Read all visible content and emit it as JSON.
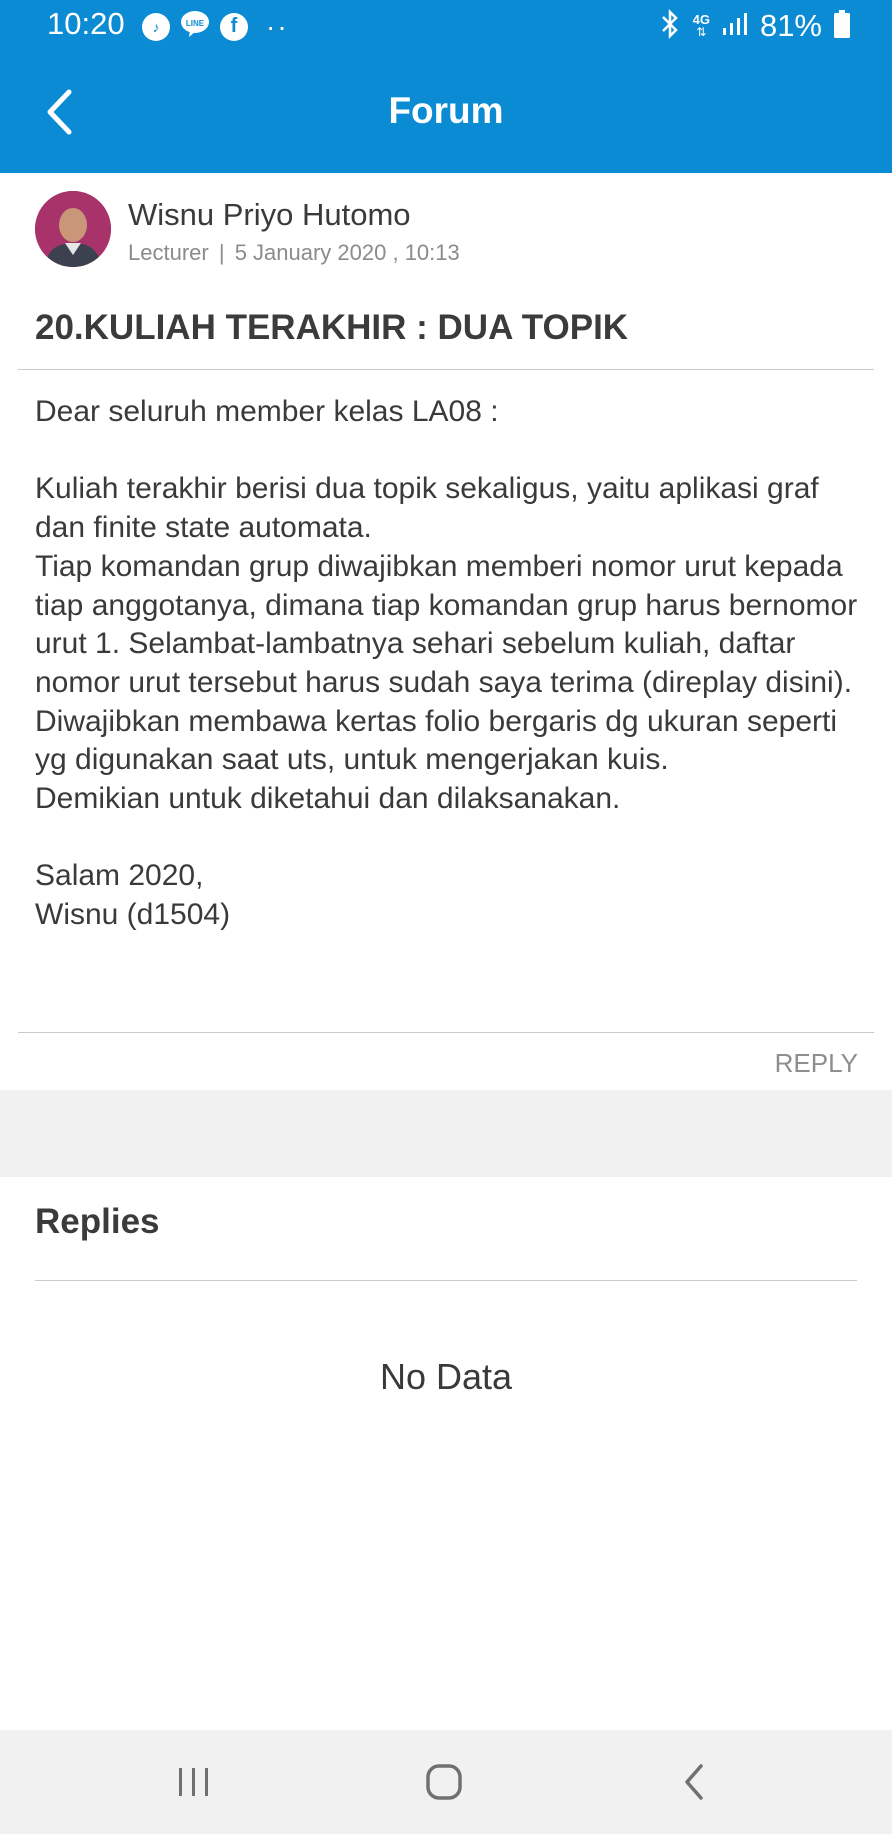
{
  "status_bar": {
    "time": "10:20",
    "battery": "81%",
    "network": "4G",
    "icons": [
      "music-icon",
      "line-icon",
      "facebook-icon",
      "more-dots-icon",
      "bluetooth-icon",
      "network-4g-icon",
      "signal-icon",
      "battery-icon"
    ]
  },
  "appbar": {
    "title": "Forum",
    "back_icon": "chevron-left-icon"
  },
  "post": {
    "author": "Wisnu Priyo Hutomo",
    "role": "Lecturer",
    "separator": "|",
    "date": "5 January 2020 , 10:13",
    "title": "20.KULIAH TERAKHIR : DUA TOPIK",
    "body": [
      "Dear seluruh member kelas LA08 :",
      "",
      "Kuliah terakhir berisi dua topik sekaligus, yaitu aplikasi graf dan finite state automata.",
      "Tiap komandan grup diwajibkan memberi nomor urut kepada tiap anggotanya, dimana tiap komandan grup harus bernomor urut 1. Selambat-lambatnya sehari sebelum kuliah, daftar nomor urut tersebut harus sudah saya terima (direplay disini).",
      "Diwajibkan membawa kertas folio bergaris dg ukuran seperti yg digunakan saat uts, untuk mengerjakan kuis.",
      "Demikian untuk diketahui dan dilaksanakan.",
      "",
      "Salam 2020,",
      "Wisnu (d1504)"
    ],
    "reply_label": "REPLY"
  },
  "replies": {
    "heading": "Replies",
    "empty_text": "No Data"
  },
  "navbar": {
    "icons": [
      "recent-apps-icon",
      "home-icon",
      "back-icon"
    ]
  },
  "colors": {
    "primary": "#0B8BD3",
    "text": "#3a3a3a",
    "muted": "#8b8b8b",
    "band": "#f1f1f1"
  }
}
